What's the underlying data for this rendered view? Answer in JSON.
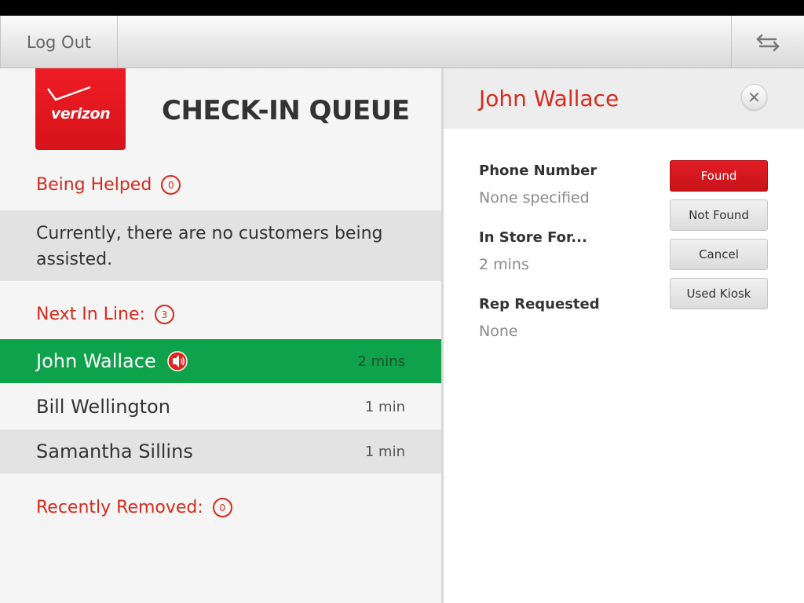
{
  "topbar": {
    "logout_label": "Log Out",
    "swap_icon": "swap-arrows-icon"
  },
  "brand": {
    "logo_text": "verizon",
    "accent": "#d52b1e"
  },
  "queue": {
    "title": "CHECK-IN QUEUE",
    "being_helped": {
      "label": "Being Helped",
      "count": "0",
      "empty_message": "Currently, there are no customers being assisted."
    },
    "next_in_line": {
      "label": "Next In Line:",
      "count": "3",
      "rows": [
        {
          "name": "John Wallace",
          "time": "2 mins",
          "selected": true,
          "alert": true
        },
        {
          "name": "Bill Wellington",
          "time": "1 min"
        },
        {
          "name": "Samantha Sillins",
          "time": "1 min"
        }
      ]
    },
    "recently_removed": {
      "label": "Recently Removed:",
      "count": "0"
    }
  },
  "detail": {
    "name": "John Wallace",
    "close_icon": "close-icon",
    "fields": [
      {
        "label": "Phone Number",
        "value": "None specified"
      },
      {
        "label": "In Store For...",
        "value": "2 mins"
      },
      {
        "label": "Rep Requested",
        "value": "None"
      }
    ],
    "actions": {
      "found": "Found",
      "not_found": "Not Found",
      "cancel": "Cancel",
      "used_kiosk": "Used Kiosk"
    }
  },
  "colors": {
    "selected_row": "#0ea24a",
    "primary_button": "#d52b1e"
  }
}
